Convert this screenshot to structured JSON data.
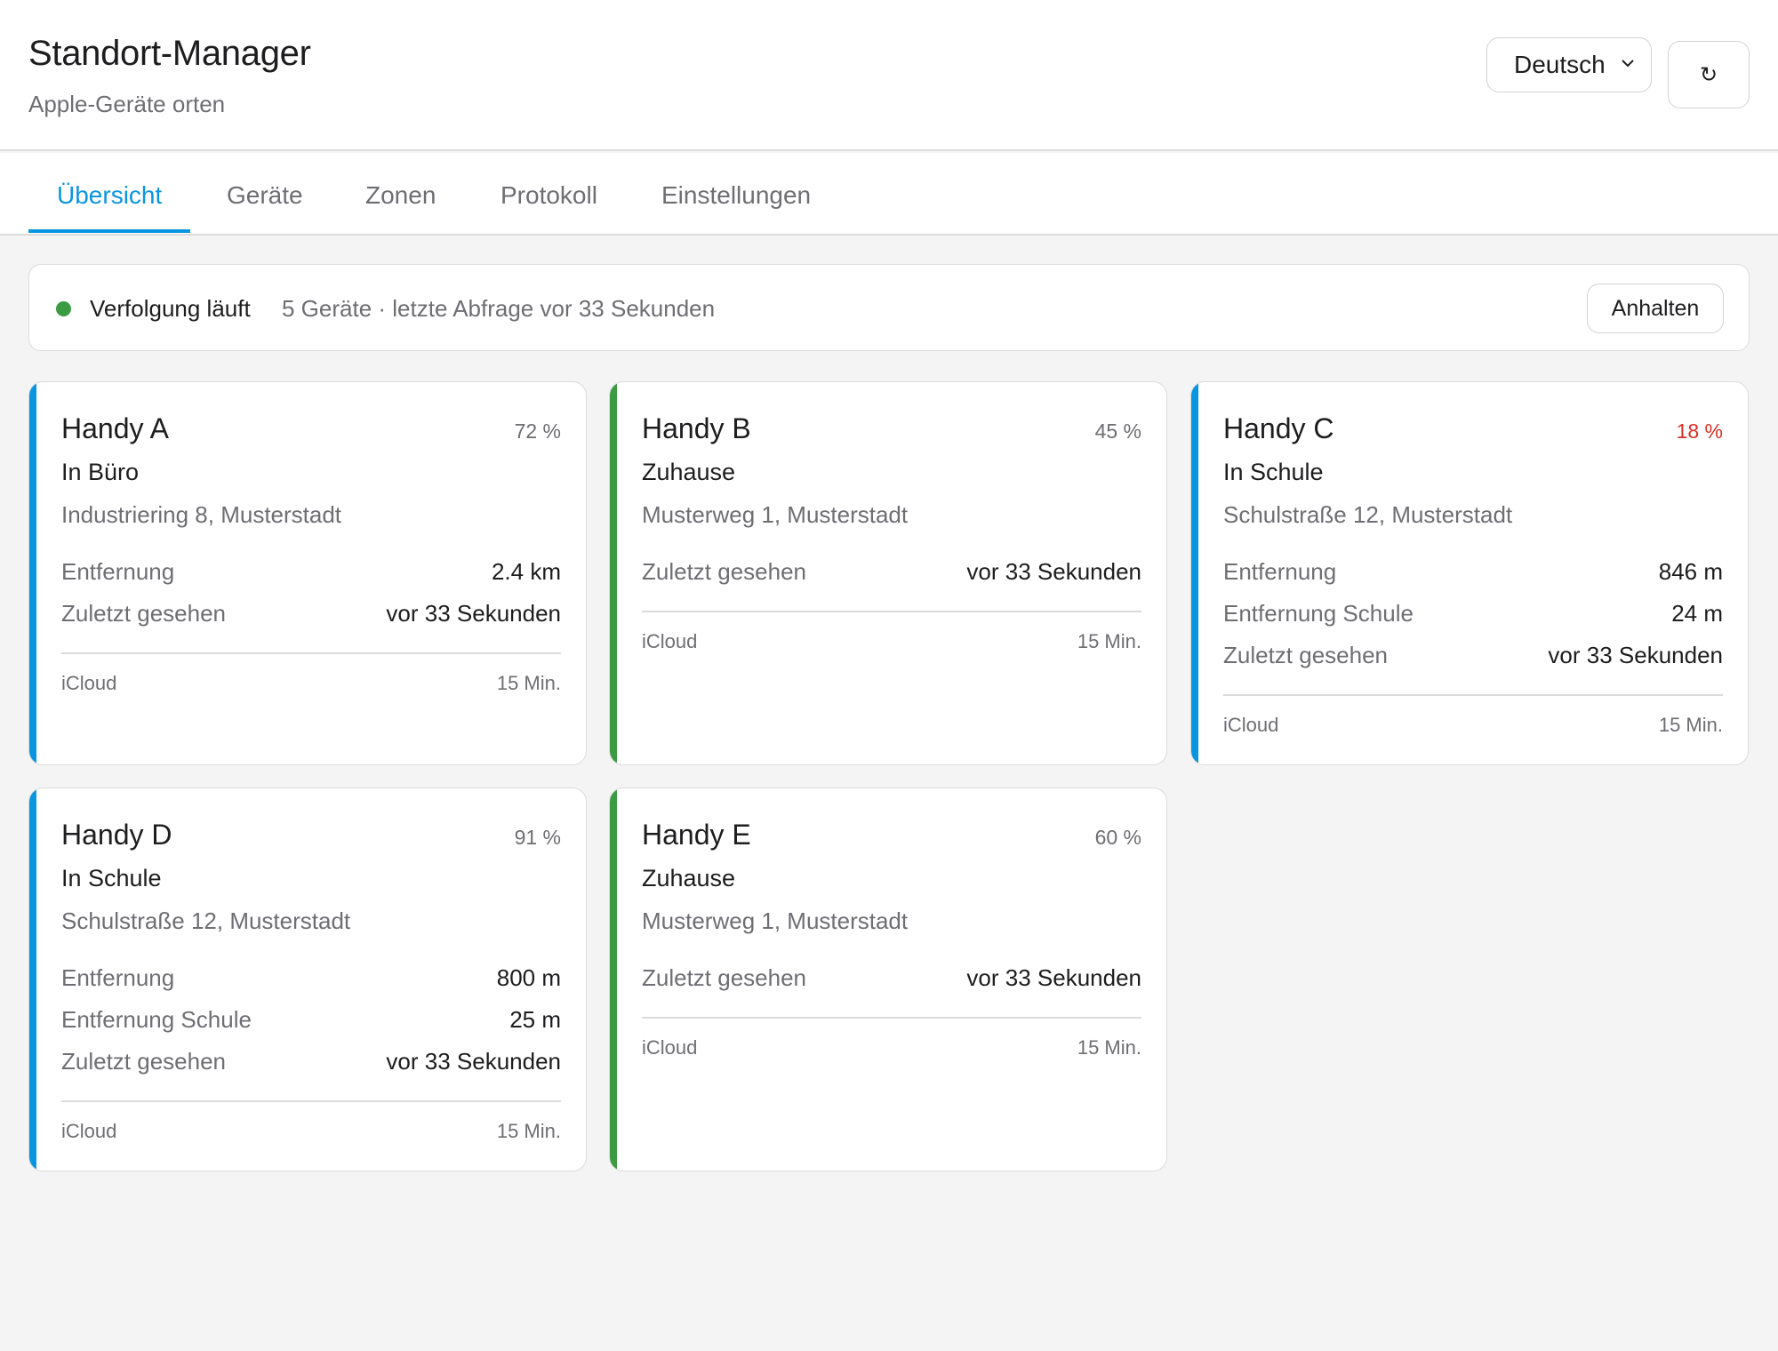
{
  "header": {
    "title": "Standort-Manager",
    "subtitle": "Apple-Geräte orten",
    "language": "Deutsch",
    "refresh_glyph": "↻"
  },
  "tabs": [
    {
      "label": "Übersicht",
      "active": true
    },
    {
      "label": "Geräte",
      "active": false
    },
    {
      "label": "Zonen",
      "active": false
    },
    {
      "label": "Protokoll",
      "active": false
    },
    {
      "label": "Einstellungen",
      "active": false
    }
  ],
  "status": {
    "label": "Verfolgung läuft",
    "detail": "5 Geräte · letzte Abfrage vor 33 Sekunden",
    "pause_label": "Anhalten",
    "dot_color": "#3a9b42"
  },
  "colors": {
    "accent": "#0a95e0",
    "zone_blue": "#0a95e0",
    "zone_green": "#3a9b42",
    "battery_low": "#d93025"
  },
  "devices": [
    {
      "name": "Handy A",
      "battery": "72 %",
      "battery_low": false,
      "zone": "In Büro",
      "address": "Industriering 8, Musterstadt",
      "rows": [
        {
          "label": "Entfernung",
          "value": "2.4 km"
        },
        {
          "label": "Zuletzt gesehen",
          "value": "vor 33 Sekunden"
        }
      ],
      "source": "iCloud",
      "interval": "15 Min.",
      "accent": "#0a95e0"
    },
    {
      "name": "Handy B",
      "battery": "45 %",
      "battery_low": false,
      "zone": "Zuhause",
      "address": "Musterweg 1, Musterstadt",
      "rows": [
        {
          "label": "Zuletzt gesehen",
          "value": "vor 33 Sekunden"
        }
      ],
      "source": "iCloud",
      "interval": "15 Min.",
      "accent": "#3a9b42"
    },
    {
      "name": "Handy C",
      "battery": "18 %",
      "battery_low": true,
      "zone": "In Schule",
      "address": "Schulstraße 12, Musterstadt",
      "rows": [
        {
          "label": "Entfernung",
          "value": "846 m"
        },
        {
          "label": "Entfernung Schule",
          "value": "24 m"
        },
        {
          "label": "Zuletzt gesehen",
          "value": "vor 33 Sekunden"
        }
      ],
      "source": "iCloud",
      "interval": "15 Min.",
      "accent": "#0a95e0"
    },
    {
      "name": "Handy D",
      "battery": "91 %",
      "battery_low": false,
      "zone": "In Schule",
      "address": "Schulstraße 12, Musterstadt",
      "rows": [
        {
          "label": "Entfernung",
          "value": "800 m"
        },
        {
          "label": "Entfernung Schule",
          "value": "25 m"
        },
        {
          "label": "Zuletzt gesehen",
          "value": "vor 33 Sekunden"
        }
      ],
      "source": "iCloud",
      "interval": "15 Min.",
      "accent": "#0a95e0"
    },
    {
      "name": "Handy E",
      "battery": "60 %",
      "battery_low": false,
      "zone": "Zuhause",
      "address": "Musterweg 1, Musterstadt",
      "rows": [
        {
          "label": "Zuletzt gesehen",
          "value": "vor 33 Sekunden"
        }
      ],
      "source": "iCloud",
      "interval": "15 Min.",
      "accent": "#3a9b42"
    }
  ]
}
